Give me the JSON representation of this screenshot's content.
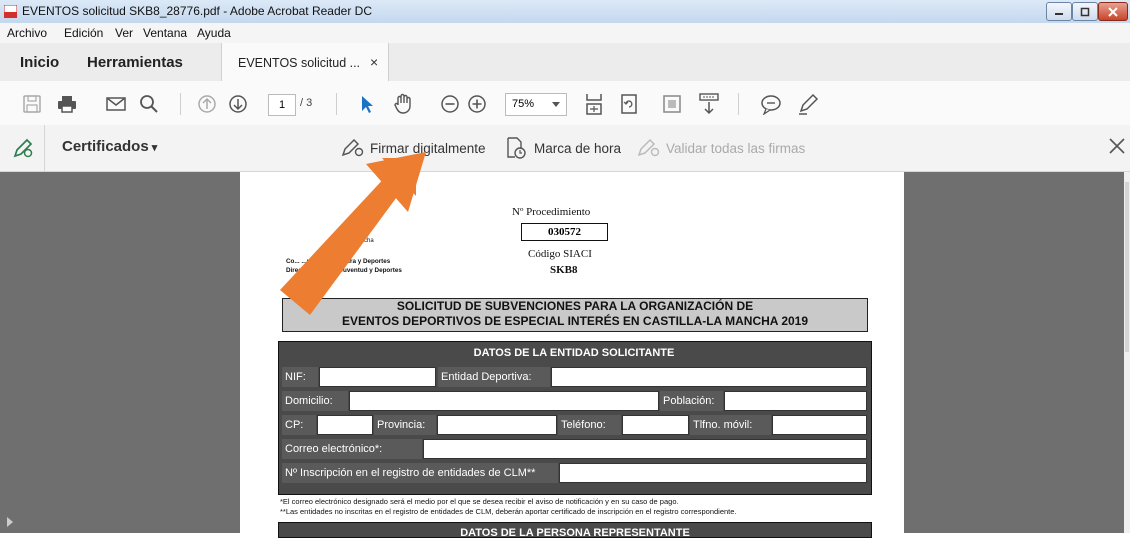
{
  "window": {
    "title": "EVENTOS solicitud SKB8_28776.pdf - Adobe Acrobat Reader DC"
  },
  "menu": [
    "Archivo",
    "Edición",
    "Ver",
    "Ventana",
    "Ayuda"
  ],
  "tabs": {
    "home": "Inicio",
    "tools": "Herramientas",
    "document": "EVENTOS solicitud ...",
    "close": "×"
  },
  "toolbar": {
    "page_current": "1",
    "page_total": "/ 3",
    "zoom": "75%"
  },
  "certbar": {
    "title": "Certificados",
    "sign": "Firmar digitalmente",
    "timestamp": "Marca de hora",
    "validate": "Validar todas las firmas"
  },
  "document": {
    "header_left": {
      "line1": "la Mancha",
      "line2": "Co... ...ucación, Cultura y Deportes",
      "line3": "Direcc... ...eral de Juventud y Deportes"
    },
    "procedure_label": "Nº Procedimiento",
    "procedure_code": "030572",
    "siaci_label": "Código SIACI",
    "siaci_code": "SKB8",
    "main_title_1": "SOLICITUD DE SUBVENCIONES PARA LA ORGANIZACIÓN DE",
    "main_title_2": "EVENTOS DEPORTIVOS DE ESPECIAL INTERÉS EN CASTILLA-LA MANCHA 2019",
    "section1": "DATOS DE LA ENTIDAD SOLICITANTE",
    "fields": {
      "nif": "NIF:",
      "entidad": "Entidad Deportiva:",
      "domicilio": "Domicilio:",
      "poblacion": "Población:",
      "cp": "CP:",
      "provincia": "Provincia:",
      "telefono": "Teléfono:",
      "movil": "Tlfno. móvil:",
      "correo": "Correo electrónico*:",
      "inscripcion": "Nº Inscripción en el registro de entidades de CLM**"
    },
    "note1": "*El correo electrónico designado será el medio por el que se desea recibir el aviso de notificación y en su caso de pago.",
    "note2": "**Las entidades no inscritas en el registro de entidades de CLM, deberán aportar certificado de inscripción en el registro correspondiente.",
    "section2": "DATOS DE LA PERSONA REPRESENTANTE"
  },
  "colors": {
    "arrow": "#ed7d31",
    "cert_icon": "#2e7d4f",
    "cursor": "#1a73c7"
  }
}
